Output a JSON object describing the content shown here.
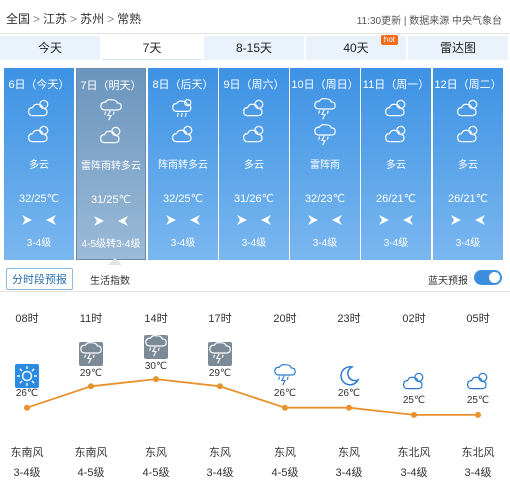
{
  "breadcrumb": {
    "country": "全国",
    "province": "江苏",
    "city": "苏州",
    "district": "常熟",
    "separator": ">"
  },
  "update": {
    "text": "11:30更新 | 数据来源 中央气象台"
  },
  "tabs": [
    {
      "label": "今天"
    },
    {
      "label": "7天"
    },
    {
      "label": "8-15天"
    },
    {
      "label": "40天",
      "badge": "hot"
    },
    {
      "label": "雷达图"
    }
  ],
  "forecast": [
    {
      "date": "6日（今天）",
      "desc": "多云",
      "temp": "32/25℃",
      "level": "3-4级",
      "icon_day": "partly-cloudy-icon",
      "icon_night": "cloudy-night-icon"
    },
    {
      "date": "7日（明天）",
      "desc": "雷阵雨转多云",
      "temp": "31/25℃",
      "level": "4-5级转3-4级",
      "icon_day": "thunderstorm-icon",
      "icon_night": "cloudy-night-icon"
    },
    {
      "date": "8日（后天）",
      "desc": "阵雨转多云",
      "temp": "32/25℃",
      "level": "3-4级",
      "icon_day": "shower-icon",
      "icon_night": "cloudy-night-icon"
    },
    {
      "date": "9日（周六）",
      "desc": "多云",
      "temp": "31/26℃",
      "level": "3-4级",
      "icon_day": "partly-cloudy-icon",
      "icon_night": "cloudy-night-icon"
    },
    {
      "date": "10日（周日）",
      "desc": "雷阵雨",
      "temp": "32/23℃",
      "level": "3-4级",
      "icon_day": "thunderstorm-icon",
      "icon_night": "thunderstorm-icon"
    },
    {
      "date": "11日（周一）",
      "desc": "多云",
      "temp": "26/21℃",
      "level": "3-4级",
      "icon_day": "partly-cloudy-icon",
      "icon_night": "cloudy-night-icon"
    },
    {
      "date": "12日（周二）",
      "desc": "多云",
      "temp": "26/21℃",
      "level": "3-4级",
      "icon_day": "partly-cloudy-icon",
      "icon_night": "cloudy-night-icon"
    }
  ],
  "subbar": {
    "tab_hourly": "分时段预报",
    "tab_life": "生活指数",
    "bluesky": "蓝天预报"
  },
  "hourly": [
    {
      "time": "08时",
      "temp": "26℃",
      "temp_value": 26,
      "wind": "东南风",
      "level": "3-4级",
      "icon": "sunny-icon"
    },
    {
      "time": "11时",
      "temp": "29℃",
      "temp_value": 29,
      "wind": "东南风",
      "level": "4-5级",
      "icon": "thunderstorm-icon"
    },
    {
      "time": "14时",
      "temp": "30℃",
      "temp_value": 30,
      "wind": "东风",
      "level": "4-5级",
      "icon": "thunderstorm-icon"
    },
    {
      "time": "17时",
      "temp": "29℃",
      "temp_value": 29,
      "wind": "东风",
      "level": "3-4级",
      "icon": "thunderstorm-icon"
    },
    {
      "time": "20时",
      "temp": "26℃",
      "temp_value": 26,
      "wind": "东风",
      "level": "4-5级",
      "icon": "thunderstorm-night-icon"
    },
    {
      "time": "23时",
      "temp": "26℃",
      "temp_value": 26,
      "wind": "东风",
      "level": "3-4级",
      "icon": "moon-icon"
    },
    {
      "time": "02时",
      "temp": "25℃",
      "temp_value": 25,
      "wind": "东北风",
      "level": "3-4级",
      "icon": "cloudy-night-icon"
    },
    {
      "time": "05时",
      "temp": "25℃",
      "temp_value": 25,
      "wind": "东北风",
      "level": "3-4级",
      "icon": "cloudy-night-icon"
    }
  ],
  "colors": {
    "card_top": "#3d92e4",
    "card_bottom": "#7ab7ef",
    "curve": "#e8922e",
    "toggle": "#3e8ee0"
  }
}
